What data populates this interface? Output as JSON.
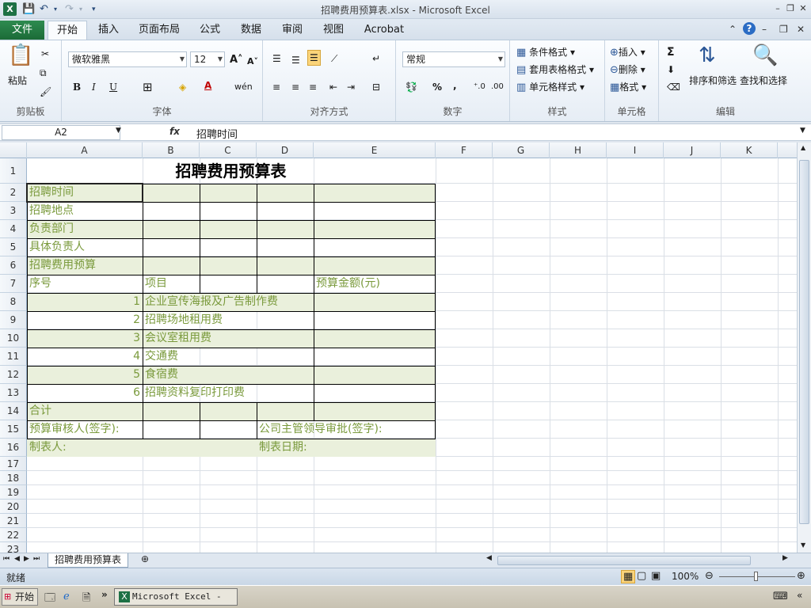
{
  "window": {
    "title": "招聘费用预算表.xlsx - Microsoft Excel",
    "minimize": "–",
    "restore": "❐",
    "close": "✕"
  },
  "ribbon_tabs": {
    "file": "文件",
    "items": [
      "开始",
      "插入",
      "页面布局",
      "公式",
      "数据",
      "审阅",
      "视图",
      "Acrobat"
    ],
    "active": "开始"
  },
  "ribbon": {
    "clipboard": {
      "paste": "粘贴",
      "group_label": "剪贴板"
    },
    "font": {
      "name": "微软雅黑",
      "size": "12",
      "bold": "B",
      "italic": "I",
      "underline": "U",
      "group_label": "字体"
    },
    "alignment": {
      "group_label": "对齐方式"
    },
    "number": {
      "format": "常规",
      "percent": "%",
      "comma": ",",
      "group_label": "数字"
    },
    "styles": {
      "conditional": "条件格式",
      "table": "套用表格格式",
      "cell": "单元格样式",
      "group_label": "样式"
    },
    "cells": {
      "insert": "插入",
      "delete": "删除",
      "format": "格式",
      "group_label": "单元格"
    },
    "editing": {
      "sum": "Σ",
      "sort": "排序和筛选",
      "find": "查找和选择",
      "group_label": "编辑"
    }
  },
  "formula_bar": {
    "name_box": "A2",
    "fx": "fx",
    "content": "招聘时间"
  },
  "columns": [
    "A",
    "B",
    "C",
    "D",
    "E",
    "F",
    "G",
    "H",
    "I",
    "J",
    "K"
  ],
  "rows": [
    "1",
    "2",
    "3",
    "4",
    "5",
    "6",
    "7",
    "8",
    "9",
    "10",
    "11",
    "12",
    "13",
    "14",
    "15",
    "16",
    "17",
    "18",
    "19",
    "20",
    "21",
    "22",
    "23"
  ],
  "sheet": {
    "title": "招聘费用预算表",
    "r2": "招聘时间",
    "r3": "招聘地点",
    "r4": "负责部门",
    "r5": "具体负责人",
    "r6": "招聘费用预算",
    "r7a": "序号",
    "r7b": "项目",
    "r7e": "预算金额(元)",
    "items": [
      {
        "no": "1",
        "name": "企业宣传海报及广告制作费"
      },
      {
        "no": "2",
        "name": "招聘场地租用费"
      },
      {
        "no": "3",
        "name": "会议室租用费"
      },
      {
        "no": "4",
        "name": "交通费"
      },
      {
        "no": "5",
        "name": "食宿费"
      },
      {
        "no": "6",
        "name": "招聘资料复印打印费"
      }
    ],
    "r14": "合计",
    "r15a": "预算审核人(签字):",
    "r15d": "公司主管领导审批(签字):",
    "r16a": "制表人:",
    "r16d": "制表日期:"
  },
  "sheet_tab": "招聘费用预算表",
  "status": {
    "text": "就绪",
    "zoom": "100%"
  },
  "taskbar": {
    "start": "开始",
    "excel": "Microsoft Excel - ..."
  }
}
